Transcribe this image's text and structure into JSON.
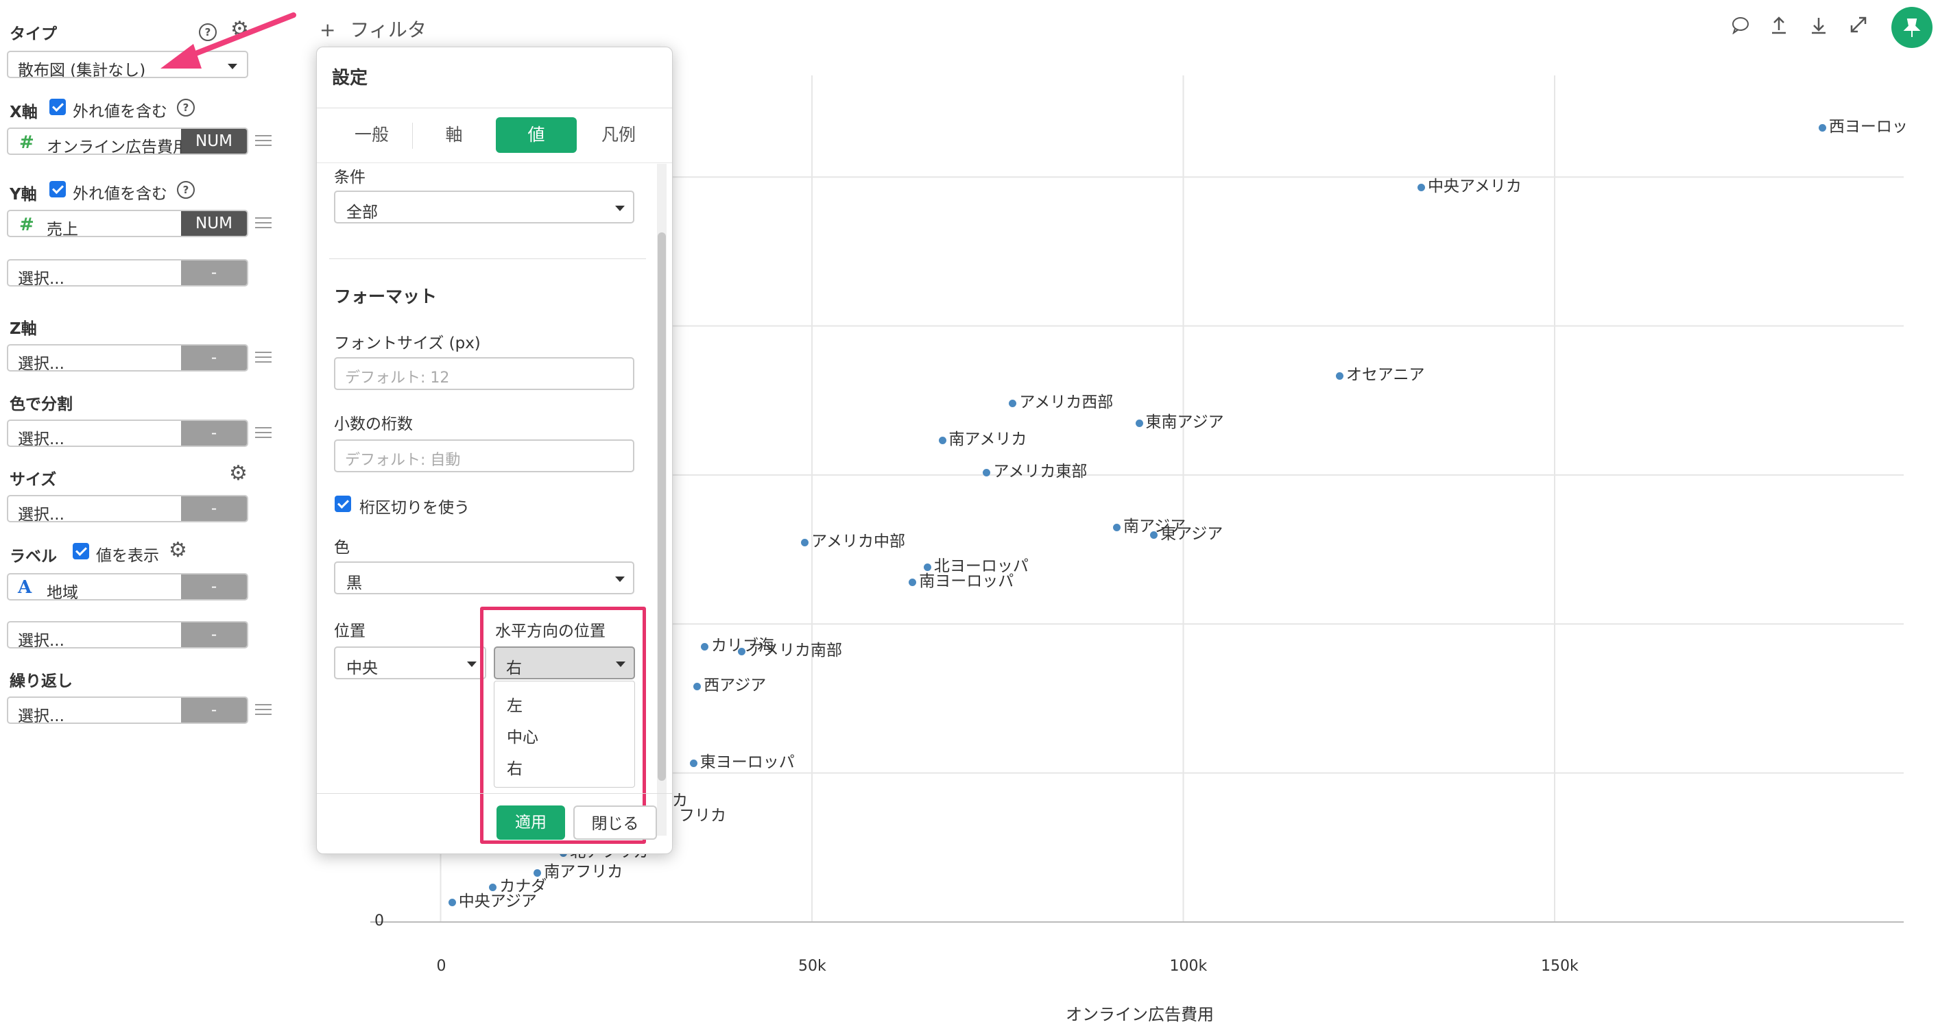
{
  "left_panel": {
    "type": {
      "label": "タイプ",
      "value": "散布図 (集計なし)"
    },
    "x_axis": {
      "label": "X軸",
      "checkbox_label": "外れ値を含む",
      "field": "オンライン広告費用",
      "tag": "NUM"
    },
    "y_axis": {
      "label": "Y軸",
      "checkbox_label": "外れ値を含む",
      "field": "売上",
      "tag": "NUM",
      "extra": "選択..."
    },
    "z_axis": {
      "label": "Z軸",
      "field": "選択...",
      "tag": "-"
    },
    "color_split": {
      "label": "色で分割",
      "field": "選択...",
      "tag": "-"
    },
    "size": {
      "label": "サイズ",
      "field": "選択...",
      "tag": "-"
    },
    "label": {
      "label": "ラベル",
      "checkbox_label": "値を表示",
      "field": "地域",
      "tag": "-",
      "extra": "選択..."
    },
    "repeat": {
      "label": "繰り返し",
      "field": "選択...",
      "tag": "-"
    },
    "extra_tag": "-"
  },
  "toolbar": {
    "filter_label": "フィルタ",
    "plus": "+"
  },
  "icons": {
    "comment": "comment-icon",
    "upload": "upload-icon",
    "download": "download-icon",
    "expand": "expand-icon",
    "pin": "pin-icon"
  },
  "colors": {
    "accent": "#1aaa6e",
    "point": "#4a89c0",
    "arrow": "#f03e7a",
    "highlight": "#e6336b"
  },
  "chart_data": {
    "type": "scatter",
    "xlabel": "オンライン広告費用",
    "ylabel": "",
    "x_ticks": [
      "0",
      "50k",
      "100k",
      "150k"
    ],
    "y_ticks": [
      "0"
    ],
    "grid": true,
    "points": [
      {
        "label": "西ヨーロッ",
        "x": 186000,
        "y": 320
      },
      {
        "label": "中央アメリカ",
        "x": 132000,
        "y": 296
      },
      {
        "label": "オセアニア",
        "x": 121000,
        "y": 220
      },
      {
        "label": "アメリカ西部",
        "x": 77000,
        "y": 209
      },
      {
        "label": "東南アジア",
        "x": 94000,
        "y": 201
      },
      {
        "label": "南アメリカ",
        "x": 67500,
        "y": 194
      },
      {
        "label": "アメリカ東部",
        "x": 73500,
        "y": 181
      },
      {
        "label": "南アジア",
        "x": 91000,
        "y": 159
      },
      {
        "label": "東アジア",
        "x": 96000,
        "y": 156
      },
      {
        "label": "アメリカ中部",
        "x": 49000,
        "y": 153
      },
      {
        "label": "北ヨーロッパ",
        "x": 65500,
        "y": 143
      },
      {
        "label": "南ヨーロッパ",
        "x": 63500,
        "y": 137
      },
      {
        "label": "カリブ海",
        "x": 35500,
        "y": 111
      },
      {
        "label": "アメリカ南部",
        "x": 40500,
        "y": 109
      },
      {
        "label": "西アジア",
        "x": 34500,
        "y": 95
      },
      {
        "label": "東ヨーロッパ",
        "x": 34000,
        "y": 64
      },
      {
        "label": "東アフリカ",
        "x": 15000,
        "y": 30
      },
      {
        "label": "北アフリカ",
        "x": 16500,
        "y": 28
      },
      {
        "label": "南アフリカ",
        "x": 13000,
        "y": 20
      },
      {
        "label": "カナダ",
        "x": 7000,
        "y": 14
      },
      {
        "label": "中央アジア",
        "x": 1500,
        "y": 8
      }
    ],
    "hidden_labels": [
      {
        "text": "カ"
      },
      {
        "text": "フリカ"
      }
    ],
    "xlim": [
      -3000,
      197000
    ],
    "ylim": [
      0,
      341
    ]
  },
  "modal": {
    "title": "設定",
    "tabs": [
      "一般",
      "軸",
      "値",
      "凡例"
    ],
    "active_tab": 2,
    "condition": {
      "label": "条件",
      "value": "全部"
    },
    "format_heading": "フォーマット",
    "font_size": {
      "label": "フォントサイズ (px)",
      "placeholder": "デフォルト: 12"
    },
    "decimals": {
      "label": "小数の桁数",
      "placeholder": "デフォルト: 自動"
    },
    "thousands_sep": {
      "label": "桁区切りを使う",
      "checked": true
    },
    "color": {
      "label": "色",
      "value": "黒"
    },
    "position": {
      "label": "位置",
      "value": "中央"
    },
    "h_position": {
      "label": "水平方向の位置",
      "value": "右",
      "options": [
        "左",
        "中心",
        "右"
      ]
    },
    "apply_label": "適用",
    "close_label": "閉じる"
  }
}
